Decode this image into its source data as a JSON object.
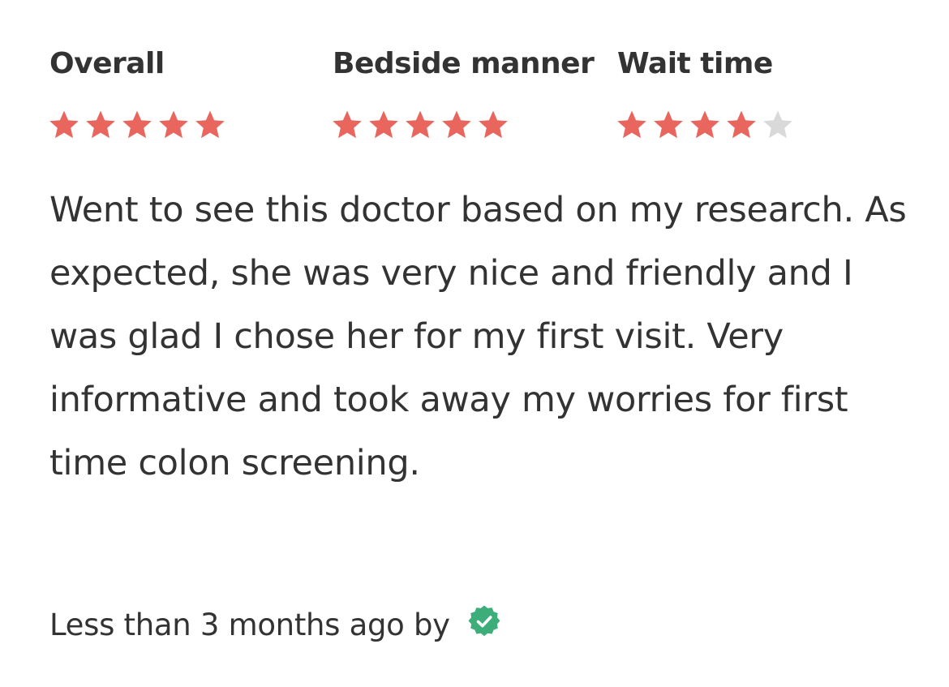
{
  "colors": {
    "star_filled": "#E8665E",
    "star_empty": "#D9D9D9",
    "verified": "#3DAE7A",
    "text": "#333333"
  },
  "ratings": [
    {
      "label": "Overall",
      "stars": 5,
      "max": 5
    },
    {
      "label": "Bedside manner",
      "stars": 5,
      "max": 5
    },
    {
      "label": "Wait time",
      "stars": 4,
      "max": 5
    }
  ],
  "review": {
    "text": "Went to see this doctor based on my research. As expected, she was very nice and friendly and I was glad I chose her for my first visit. Very informative and took away my worries for first time colon screening.",
    "meta": "Less than 3 months ago by",
    "verified_icon": "verified-badge-icon"
  }
}
